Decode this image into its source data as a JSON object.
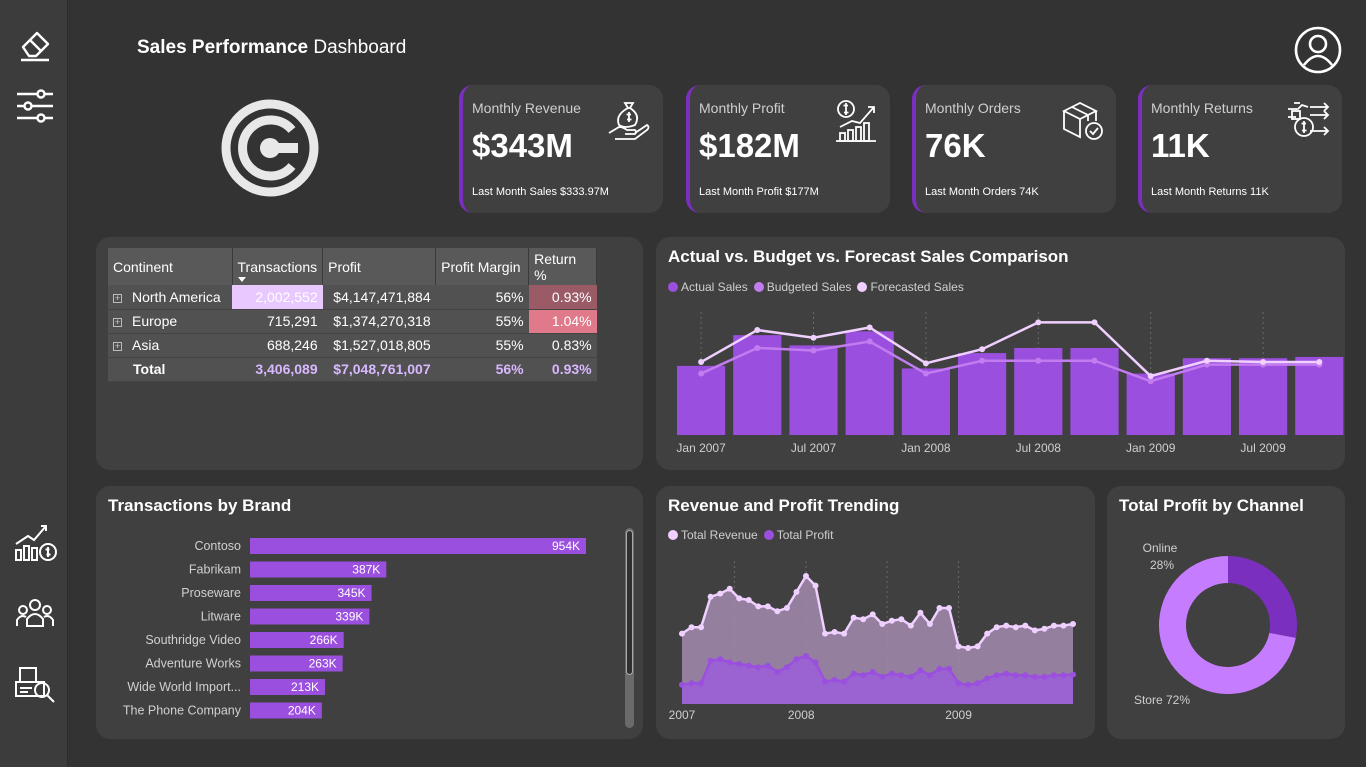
{
  "header": {
    "title_bold": "Sales Performance",
    "title_rest": "Dashboard"
  },
  "sidebar": {
    "items": [
      {
        "icon": "eraser-icon"
      },
      {
        "icon": "sliders-icon"
      },
      {
        "icon": "growth-chart-icon"
      },
      {
        "icon": "team-icon"
      },
      {
        "icon": "inspection-icon"
      }
    ]
  },
  "kpis": [
    {
      "label": "Monthly Revenue",
      "value": "$343M",
      "sub": "Last Month Sales $333.97M",
      "icon": "money-bag-hand-icon"
    },
    {
      "label": "Monthly Profit",
      "value": "$182M",
      "sub": "Last Month Profit $177M",
      "icon": "profit-growth-icon"
    },
    {
      "label": "Monthly Orders",
      "value": "76K",
      "sub": "Last Month Orders 74K",
      "icon": "package-check-icon"
    },
    {
      "label": "Monthly Returns",
      "value": "11K",
      "sub": "Last Month Returns 11K",
      "icon": "returns-icon"
    }
  ],
  "matrix": {
    "headers": [
      "Continent",
      "Transactions",
      "Profit",
      "Profit Margin",
      "Return %"
    ],
    "rows": [
      {
        "continent": "North America",
        "transactions": "2,002,552",
        "profit": "$4,147,471,884",
        "margin": "56%",
        "return": "0.93%"
      },
      {
        "continent": "Europe",
        "transactions": "715,291",
        "profit": "$1,374,270,318",
        "margin": "55%",
        "return": "1.04%"
      },
      {
        "continent": "Asia",
        "transactions": "688,246",
        "profit": "$1,527,018,805",
        "margin": "55%",
        "return": "0.83%"
      }
    ],
    "total": {
      "continent": "Total",
      "transactions": "3,406,089",
      "profit": "$7,048,761,007",
      "margin": "56%",
      "return": "0.93%"
    }
  },
  "colors": {
    "accent": "#7b2fbf",
    "bar": "#9b4fde",
    "actual": "#9b4fde",
    "budget": "#c27cf0",
    "forecast": "#efd0ff",
    "return_high": "#e07a8a",
    "return_mid": "#9a5a66",
    "transactions_bar": "#e8c8ff"
  },
  "chart_titles": {
    "budget": "Actual vs. Budget vs. Forecast Sales Comparison",
    "brand": "Transactions by Brand",
    "trend": "Revenue and Profit Trending",
    "channel": "Total Profit by Channel"
  },
  "legends": {
    "budget": [
      "Actual Sales",
      "Budgeted Sales",
      "Forecasted Sales"
    ],
    "trend": [
      "Total Revenue",
      "Total Profit"
    ]
  },
  "chart_data": [
    {
      "id": "budget",
      "type": "bar",
      "title": "Actual vs. Budget vs. Forecast Sales Comparison",
      "x_ticks": [
        "Jan 2007",
        "Jul 2007",
        "Jan 2008",
        "Jul 2008",
        "Jan 2009",
        "Jul 2009"
      ],
      "series": [
        {
          "name": "Actual Sales",
          "type": "bar",
          "values": [
            54,
            78,
            70,
            81,
            52,
            64,
            68,
            68,
            48,
            60,
            60,
            61
          ]
        },
        {
          "name": "Budgeted Sales",
          "type": "line",
          "values": [
            48,
            68,
            66,
            73,
            48,
            58,
            58,
            58,
            42,
            55,
            55,
            55
          ]
        },
        {
          "name": "Forecasted Sales",
          "type": "line",
          "values": [
            57,
            82,
            76,
            84,
            56,
            67,
            88,
            88,
            46,
            58,
            57,
            57
          ]
        }
      ]
    },
    {
      "id": "brand",
      "type": "bar",
      "title": "Transactions by Brand",
      "categories": [
        "Contoso",
        "Fabrikam",
        "Proseware",
        "Litware",
        "Southridge Video",
        "Adventure Works",
        "Wide World Import...",
        "The Phone Company"
      ],
      "values": [
        954,
        387,
        345,
        339,
        266,
        263,
        213,
        204
      ],
      "labels": [
        "954K",
        "387K",
        "345K",
        "339K",
        "266K",
        "263K",
        "213K",
        "204K"
      ]
    },
    {
      "id": "trend",
      "type": "area",
      "title": "Revenue and Profit Trending",
      "x_ticks": [
        "2007",
        "2008",
        "2009"
      ],
      "series": [
        {
          "name": "Total Revenue",
          "values": [
            220,
            240,
            240,
            335,
            345,
            360,
            330,
            325,
            305,
            305,
            290,
            300,
            350,
            400,
            370,
            220,
            225,
            220,
            270,
            265,
            280,
            250,
            260,
            265,
            245,
            285,
            250,
            300,
            300,
            180,
            175,
            180,
            220,
            240,
            245,
            240,
            245,
            230,
            235,
            245,
            245,
            250
          ]
        },
        {
          "name": "Total Profit",
          "values": [
            60,
            65,
            65,
            135,
            140,
            130,
            125,
            120,
            115,
            120,
            100,
            115,
            140,
            150,
            130,
            70,
            75,
            70,
            95,
            90,
            100,
            85,
            95,
            90,
            85,
            105,
            90,
            110,
            110,
            65,
            60,
            65,
            80,
            90,
            95,
            90,
            90,
            85,
            85,
            90,
            90,
            92
          ]
        }
      ]
    },
    {
      "id": "channel",
      "type": "pie",
      "title": "Total Profit by Channel",
      "slices": [
        {
          "name": "Online",
          "value": 28,
          "label": "28%"
        },
        {
          "name": "Store",
          "value": 72,
          "label": "Store 72%"
        }
      ]
    }
  ]
}
